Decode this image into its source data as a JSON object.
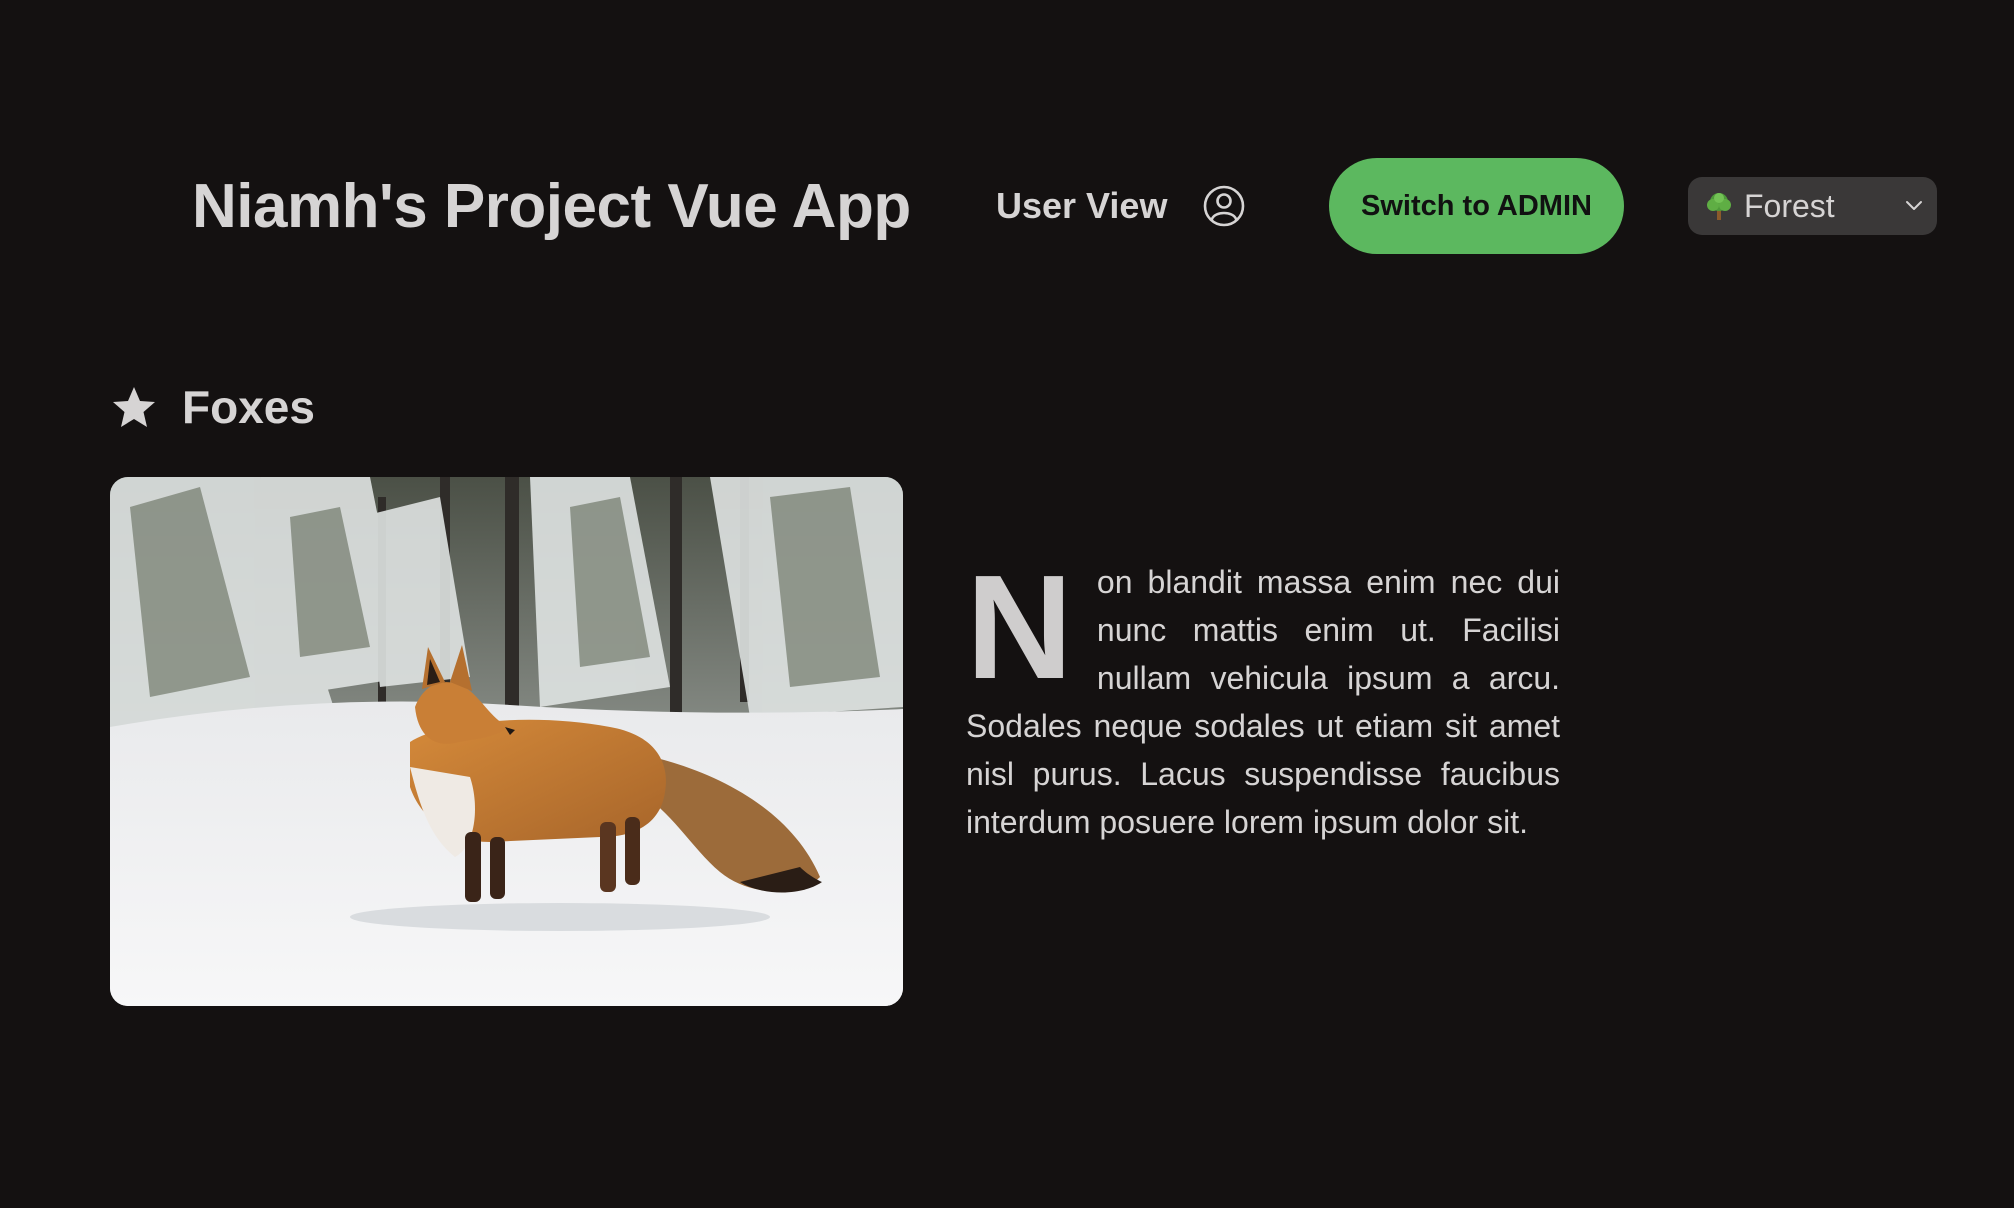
{
  "header": {
    "app_title": "Niamh's Project Vue App",
    "view_label": "User View",
    "user_icon": "user-circle-icon",
    "admin_button_label": "Switch to ADMIN",
    "theme_select": {
      "selected": "Forest",
      "icon": "tree-emoji",
      "chevron_icon": "chevron-down-icon"
    }
  },
  "section": {
    "icon": "star-icon",
    "title": "Foxes"
  },
  "article": {
    "drop_cap": "N",
    "body": "on blandit massa enim nec dui nunc mattis enim ut. Facilisi nullam vehicula ipsum a arcu. Sodales neque sodales ut etiam sit amet nisl purus. Lacus suspendisse faucibus interdum posuere lorem ipsum dolor sit."
  },
  "colors": {
    "background": "#141111",
    "text": "#d6d4d4",
    "admin_button": "#5cb85f",
    "select_bg": "#3a3838"
  }
}
